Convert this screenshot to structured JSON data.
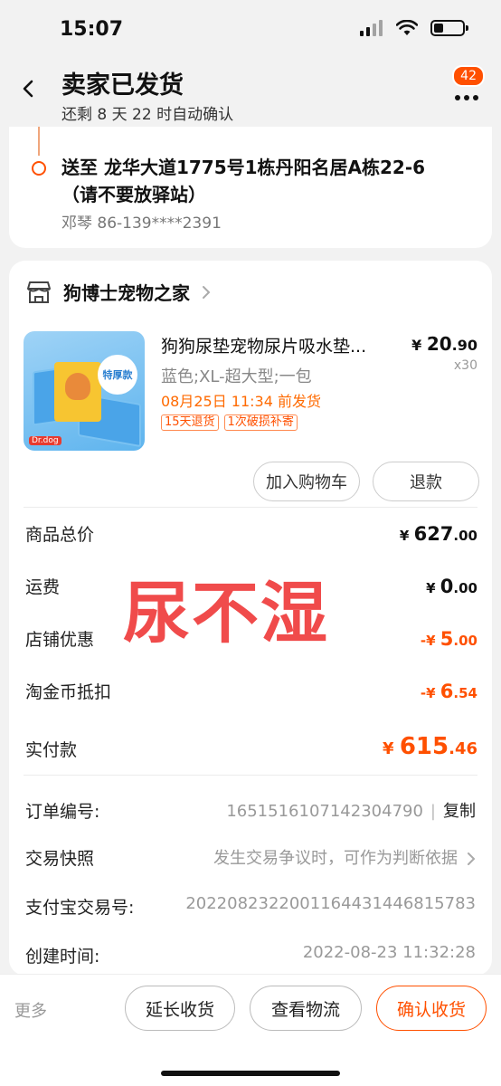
{
  "status_bar": {
    "time": "15:07"
  },
  "nav": {
    "title": "卖家已发货",
    "subtitle": "还剩 8 天 22 时自动确认",
    "message_count": "42"
  },
  "address": {
    "text": "送至 龙华大道1775号1栋丹阳名居A栋22-6（请不要放驿站）",
    "contact": "邓琴 86-139****2391"
  },
  "shop": {
    "name": "狗博士宠物之家"
  },
  "product": {
    "image_badge": "特厚款",
    "image_brand": "Dr.dog",
    "name": "狗狗尿垫宠物尿片吸水垫...",
    "price_symbol": "¥",
    "price_int": "20",
    "price_dec": ".90",
    "quantity": "x30",
    "spec": "蓝色;XL-超大型;一包",
    "ship_note": "08月25日 11:34 前发货",
    "tags": [
      "15天退货",
      "1次破损补寄"
    ]
  },
  "actions": {
    "add_cart": "加入购物车",
    "refund": "退款"
  },
  "fees": [
    {
      "label": "商品总价",
      "sym": "¥",
      "int": "627",
      "dec": ".00",
      "orange": false
    },
    {
      "label": "运费",
      "sym": "¥",
      "int": "0",
      "dec": ".00",
      "orange": false
    },
    {
      "label": "店铺优惠",
      "sym": "-¥",
      "int": "5",
      "dec": ".00",
      "orange": true
    },
    {
      "label": "淘金币抵扣",
      "sym": "-¥",
      "int": "6",
      "dec": ".54",
      "orange": true
    }
  ],
  "total": {
    "label": "实付款",
    "sym": "¥",
    "int": "615",
    "dec": ".46"
  },
  "overlay_text": "尿不湿",
  "info": {
    "order_no_label": "订单编号:",
    "order_no": "1651516107142304790",
    "copy": "复制",
    "snapshot_label": "交易快照",
    "snapshot_value": "发生交易争议时，可作为判断依据",
    "alipay_label": "支付宝交易号:",
    "alipay_value": "2022082322001164431446815783",
    "created_label": "创建时间:",
    "created_value": "2022-08-23 11:32:28"
  },
  "bottom": {
    "more": "更多",
    "extend": "延长收货",
    "track": "查看物流",
    "confirm": "确认收货"
  },
  "colors": {
    "accent": "#ff5000",
    "overlay": "#f04b4b"
  }
}
